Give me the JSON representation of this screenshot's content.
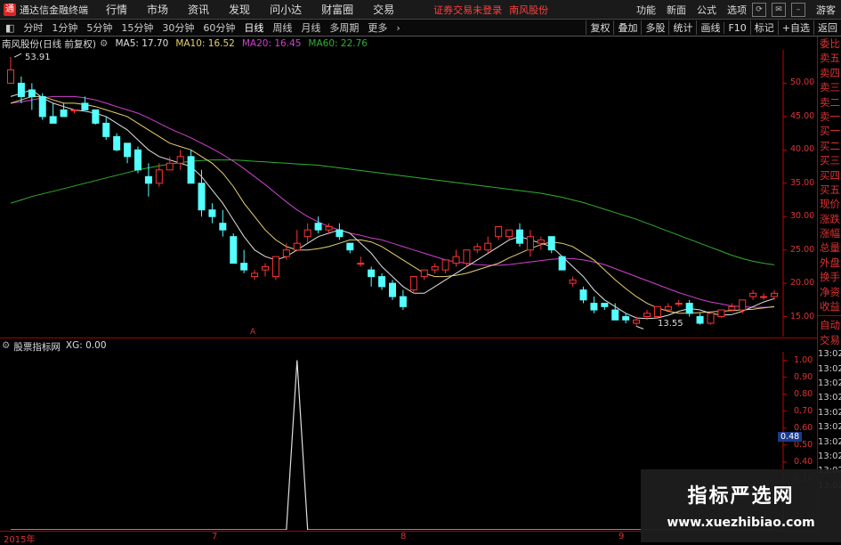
{
  "app": {
    "title": "通达信金融终端",
    "logo": "通"
  },
  "menu": [
    "行情",
    "市场",
    "资讯",
    "发现",
    "问小达",
    "财富圈",
    "交易"
  ],
  "status_warning": "证券交易未登录",
  "stock_name": "南风股份",
  "right_menu": [
    "功能",
    "新面",
    "公式",
    "选项"
  ],
  "guest": "游客",
  "periods": [
    "分时",
    "1分钟",
    "5分钟",
    "15分钟",
    "30分钟",
    "60分钟",
    "日线",
    "周线",
    "月线",
    "多周期",
    "更多"
  ],
  "active_period": "日线",
  "tools": [
    "复权",
    "叠加",
    "多股",
    "统计",
    "画线",
    "F10",
    "标记",
    "+自选",
    "返回"
  ],
  "info": {
    "stock_label": "南风股份(日线 前复权)",
    "ma5": "MA5: 17.70",
    "ma10": "MA10: 16.52",
    "ma20": "MA20: 16.45",
    "ma60": "MA60: 22.76"
  },
  "indicator": {
    "label": "股票指标网",
    "xg": "XG: 0.00"
  },
  "price_ticks": [
    "50.00",
    "45.00",
    "40.00",
    "35.00",
    "30.00",
    "25.00",
    "20.00",
    "15.00"
  ],
  "ind_ticks": [
    "1.00",
    "0.90",
    "0.80",
    "0.70",
    "0.60",
    "0.50",
    "0.40",
    "0.30"
  ],
  "ind_value_tag": "0.48",
  "annotations": {
    "high": "53.91",
    "low": "13.55",
    "marker": "A"
  },
  "x_labels": [
    "2015年",
    "7",
    "8",
    "9"
  ],
  "right_panel": {
    "top_items": [
      "委比",
      "卖五",
      "卖四",
      "卖三",
      "卖二",
      "卖一",
      "买一",
      "买二",
      "买三",
      "买四",
      "买五",
      "现价",
      "涨跌",
      "涨幅",
      "总量",
      "外盘",
      "换手",
      "净资",
      "收益"
    ],
    "bottom_items": [
      "自动",
      "交易",
      "13:02",
      "13:02",
      "13:02",
      "13:02",
      "13:02",
      "13:02",
      "13:02",
      "13:02",
      "13:02",
      "13:02"
    ]
  },
  "watermark": {
    "title": "指标严选网",
    "url": "www.xuezhibiao.com"
  },
  "colors": {
    "up": "#ff3333",
    "down": "#54ffff",
    "ma5": "#e0e0e0",
    "ma10": "#e8d070",
    "ma20": "#d040d0",
    "ma60": "#30b030",
    "axis": "#cc0000"
  },
  "chart_data": {
    "type": "candlestick",
    "candles": [
      [
        50,
        53.91,
        52,
        50
      ],
      [
        50,
        51,
        48,
        47
      ],
      [
        49,
        50,
        48,
        46
      ],
      [
        48,
        48.5,
        45,
        44.5
      ],
      [
        45,
        47,
        44,
        44
      ],
      [
        46,
        47,
        45,
        45
      ],
      [
        46,
        46,
        46,
        45.5
      ],
      [
        47,
        48,
        46,
        46
      ],
      [
        46,
        46,
        44,
        43.8
      ],
      [
        44,
        45,
        42,
        41.5
      ],
      [
        42,
        42.5,
        40,
        39.8
      ],
      [
        41,
        41,
        39,
        38
      ],
      [
        40,
        40.5,
        37,
        36.5
      ],
      [
        36,
        38,
        35,
        33
      ],
      [
        35,
        38,
        37,
        34.5
      ],
      [
        37,
        39,
        38,
        37
      ],
      [
        38,
        40,
        39,
        37
      ],
      [
        39,
        40,
        35,
        35
      ],
      [
        35,
        37,
        31,
        30
      ],
      [
        31,
        32,
        30,
        29
      ],
      [
        29,
        31,
        28,
        27
      ],
      [
        27,
        27.5,
        23,
        23
      ],
      [
        23,
        25,
        22,
        21.5
      ],
      [
        21,
        22,
        21.5,
        20.5
      ],
      [
        22,
        23,
        22.5,
        21
      ],
      [
        21,
        23,
        24,
        20.5
      ],
      [
        24,
        26,
        25,
        23.5
      ],
      [
        25,
        28,
        26,
        24.8
      ],
      [
        27,
        29,
        28,
        26
      ],
      [
        29,
        30,
        28,
        27.5
      ],
      [
        28,
        29,
        28.5,
        27.5
      ],
      [
        28,
        29,
        27,
        26.5
      ],
      [
        26,
        26,
        25,
        24.5
      ],
      [
        23,
        24,
        23,
        22.5
      ],
      [
        22,
        22.5,
        21,
        19.5
      ],
      [
        21,
        21.5,
        19.5,
        19
      ],
      [
        20,
        20.5,
        18,
        17.5
      ],
      [
        18,
        19,
        16.5,
        16
      ],
      [
        19,
        20,
        21,
        18.5
      ],
      [
        21,
        22,
        22,
        20.5
      ],
      [
        22,
        23,
        22.5,
        21.5
      ],
      [
        22,
        23,
        23.5,
        21.5
      ],
      [
        23,
        25,
        24,
        22.5
      ],
      [
        23,
        25,
        25,
        22.5
      ],
      [
        25,
        26,
        25.5,
        24.5
      ],
      [
        25,
        27,
        26,
        24.5
      ],
      [
        27,
        28,
        28.5,
        26.5
      ],
      [
        27,
        28,
        28,
        26.5
      ],
      [
        28,
        29,
        26,
        25.5
      ],
      [
        25,
        28,
        27,
        24
      ],
      [
        26,
        27,
        26.5,
        25
      ],
      [
        27,
        27,
        25,
        24.5
      ],
      [
        24,
        24,
        22,
        22
      ],
      [
        20,
        21,
        20.5,
        19.5
      ],
      [
        19,
        19.5,
        17.5,
        17
      ],
      [
        17,
        18,
        16,
        15.5
      ],
      [
        17,
        17,
        16.5,
        16
      ],
      [
        16,
        17,
        14.5,
        14.5
      ],
      [
        15,
        15.5,
        14.5,
        14
      ],
      [
        14,
        15,
        14.5,
        13.55
      ],
      [
        15,
        16,
        15.5,
        14.5
      ],
      [
        15,
        16.5,
        16.5,
        14.8
      ],
      [
        16,
        17,
        16.5,
        15.8
      ],
      [
        17,
        17.5,
        17,
        16.5
      ],
      [
        17,
        17.5,
        15.5,
        15
      ],
      [
        15,
        15.5,
        14,
        13.8
      ],
      [
        14,
        15,
        15.5,
        13.8
      ],
      [
        15,
        16,
        16,
        14.8
      ],
      [
        16,
        17,
        16.5,
        15.8
      ],
      [
        16,
        17.5,
        17.5,
        15.5
      ],
      [
        18,
        19,
        18.5,
        17.5
      ],
      [
        18,
        18.5,
        18,
        17.5
      ],
      [
        18,
        19,
        18.5,
        17.5
      ]
    ],
    "ma5": [
      48,
      48.5,
      49,
      47.8,
      47,
      46.5,
      46,
      45.8,
      45.5,
      45,
      44,
      43,
      41.5,
      40,
      39,
      38.5,
      38,
      37.5,
      36,
      34,
      32,
      29.5,
      27,
      25,
      24,
      23.5,
      24,
      25,
      26,
      27,
      27.5,
      28,
      27.5,
      26,
      24.5,
      22.5,
      21,
      19.5,
      18.5,
      18.5,
      19.5,
      20.5,
      21.5,
      22.5,
      23.5,
      24.5,
      25.5,
      26.5,
      27,
      26.5,
      26,
      25.5,
      24,
      22.5,
      21,
      19,
      17.5,
      16.5,
      15.5,
      14.8,
      14.7,
      14.8,
      15.2,
      15.8,
      16.2,
      16,
      15.5,
      15.2,
      15.3,
      15.8,
      16.5,
      17.2,
      17.7
    ],
    "ma10": [
      47,
      47.5,
      48,
      48,
      47.5,
      47,
      47,
      46.8,
      46.5,
      46,
      45.5,
      45,
      44,
      43,
      42,
      41,
      40.5,
      40,
      39,
      38,
      36.5,
      34.5,
      32,
      30,
      28,
      26.5,
      25.5,
      25,
      25,
      25.2,
      25.5,
      26,
      26.5,
      26.5,
      26.2,
      25.5,
      24.5,
      23.5,
      22.5,
      21.5,
      21,
      21,
      21.2,
      21.5,
      22,
      22.5,
      23,
      23.8,
      24.5,
      25.2,
      25.8,
      26.2,
      26,
      25.5,
      24.5,
      23.5,
      22,
      20.5,
      19.2,
      18,
      17,
      16.3,
      15.8,
      15.5,
      15.5,
      15.6,
      15.7,
      15.8,
      15.9,
      16,
      16.1,
      16.3,
      16.5
    ],
    "ma20": [
      47,
      47.2,
      47.5,
      47.8,
      48,
      48,
      48,
      47.8,
      47.5,
      47,
      46.5,
      46,
      45.5,
      44.8,
      44,
      43.2,
      42.5,
      41.8,
      41,
      40.2,
      39.3,
      38.3,
      37.2,
      36,
      34.8,
      33.5,
      32.2,
      31,
      30,
      29.2,
      28.5,
      28,
      27.5,
      27.2,
      26.8,
      26.5,
      26,
      25.5,
      25,
      24.5,
      24,
      23.5,
      23.2,
      23,
      22.8,
      22.7,
      22.7,
      22.8,
      23,
      23.2,
      23.4,
      23.6,
      23.7,
      23.7,
      23.5,
      23.2,
      22.8,
      22.2,
      21.6,
      21,
      20.4,
      19.8,
      19.2,
      18.6,
      18.1,
      17.6,
      17.2,
      16.9,
      16.6,
      16.5,
      16.4,
      16.4,
      16.45
    ],
    "ma60": [
      32,
      32.5,
      33,
      33.4,
      33.8,
      34.2,
      34.6,
      35,
      35.4,
      35.8,
      36.2,
      36.6,
      37,
      37.3,
      37.6,
      37.9,
      38.1,
      38.3,
      38.4,
      38.5,
      38.5,
      38.5,
      38.4,
      38.3,
      38.2,
      38.1,
      38,
      37.9,
      37.8,
      37.7,
      37.5,
      37.3,
      37.1,
      36.9,
      36.7,
      36.5,
      36.3,
      36.1,
      35.9,
      35.7,
      35.5,
      35.3,
      35.1,
      34.9,
      34.7,
      34.5,
      34.3,
      34.1,
      33.9,
      33.7,
      33.5,
      33.2,
      32.9,
      32.5,
      32.1,
      31.6,
      31.1,
      30.6,
      30.1,
      29.6,
      29,
      28.4,
      27.8,
      27.2,
      26.6,
      26,
      25.4,
      24.8,
      24.2,
      23.7,
      23.3,
      23,
      22.76
    ],
    "price_ylim": [
      12,
      55
    ],
    "indicator": {
      "name": "XG",
      "values": [
        0,
        0,
        0,
        0,
        0,
        0,
        0,
        0,
        0,
        0,
        0,
        0,
        0,
        0,
        0,
        0,
        0,
        0,
        0,
        0,
        0,
        0,
        0,
        0,
        0,
        0,
        0,
        1,
        0,
        0,
        0,
        0,
        0,
        0,
        0,
        0,
        0,
        0,
        0,
        0,
        0,
        0,
        0,
        0,
        0,
        0,
        0,
        0,
        0,
        0,
        0,
        0,
        0,
        0,
        0,
        0,
        0,
        0,
        0,
        0,
        0,
        0,
        0,
        0,
        0,
        0,
        0,
        0,
        0,
        0,
        0,
        0,
        0
      ],
      "ylim": [
        0,
        1.05
      ]
    }
  }
}
